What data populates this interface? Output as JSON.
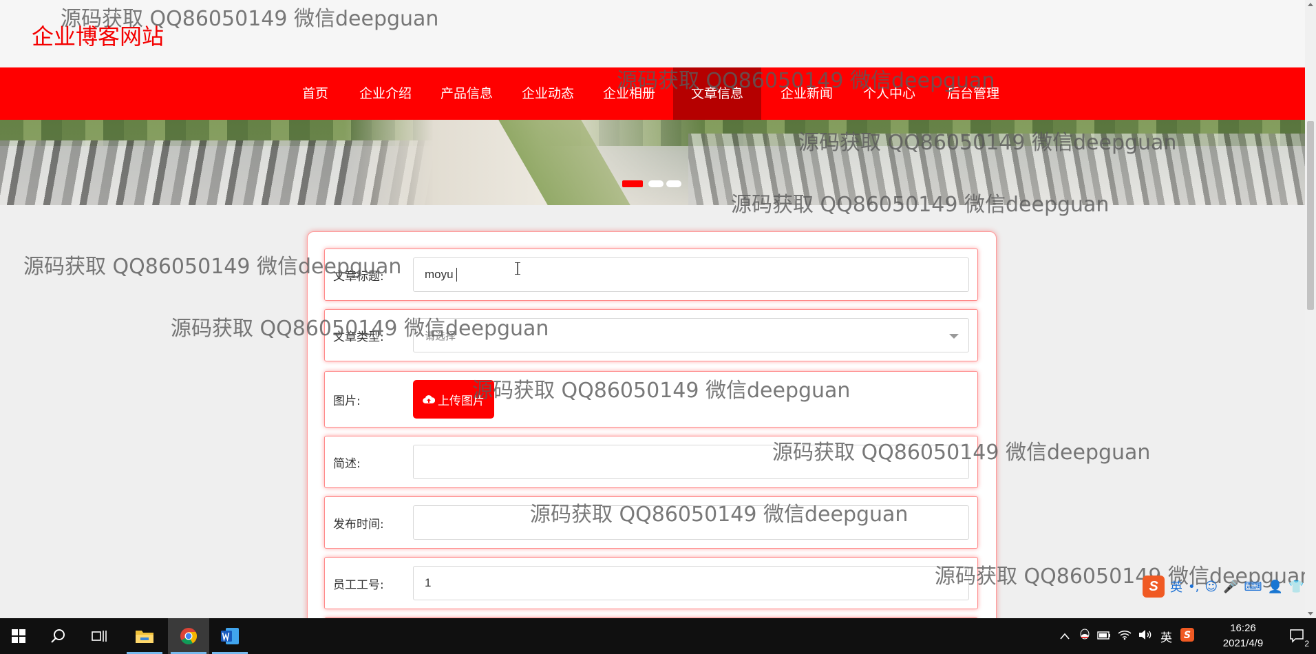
{
  "site": {
    "logo": "企业博客网站"
  },
  "nav": {
    "items": [
      {
        "label": "首页"
      },
      {
        "label": "企业介绍"
      },
      {
        "label": "产品信息"
      },
      {
        "label": "企业动态"
      },
      {
        "label": "企业相册"
      },
      {
        "label": "文章信息"
      },
      {
        "label": "企业新闻"
      },
      {
        "label": "个人中心"
      },
      {
        "label": "后台管理"
      }
    ],
    "active": "文章信息"
  },
  "banner": {
    "slides": 3,
    "active_slide": 1
  },
  "form": {
    "fields": [
      {
        "label": "文章标题:",
        "value": "moyu"
      },
      {
        "label": "文章类型:",
        "placeholder": "请选择"
      },
      {
        "label": "图片:",
        "button": "上传图片"
      },
      {
        "label": "简述:",
        "value": ""
      },
      {
        "label": "发布时间:",
        "value": ""
      },
      {
        "label": "员工工号:",
        "value": "1"
      }
    ]
  },
  "watermark": {
    "text": "源码获取 QQ86050149 微信deepguan"
  },
  "ime": {
    "logo": "S",
    "mode": "英"
  },
  "taskbar": {
    "tray_lang": "英",
    "time": "16:26",
    "date": "2021/4/9",
    "notifications": "2"
  },
  "colors": {
    "brand_red": "#ff0000",
    "nav_active": "#b50000",
    "logo_red": "#f40000",
    "taskbar": "#101010"
  }
}
